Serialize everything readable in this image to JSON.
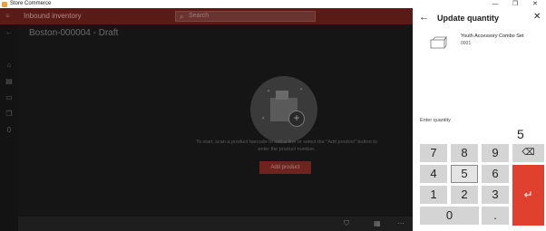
{
  "window": {
    "title": "Store Commerce",
    "min_glyph": "—",
    "max_glyph": "❐",
    "close_glyph": "✕"
  },
  "appbar": {
    "menu_glyph": "≡",
    "title": "Inbound inventory",
    "search_icon_glyph": "⌕",
    "search_placeholder": "Search"
  },
  "rail": {
    "back_glyph": "←",
    "home_glyph": "⌂",
    "products_glyph": "▤",
    "video_glyph": "▭",
    "docs_glyph": "❐",
    "count": "0"
  },
  "main": {
    "page_title": "Boston-000004 - Draft",
    "empty_text": "To start, scan a product barcode to add a line or select the \"Add product\" button to enter the product number.",
    "add_product_label": "Add product",
    "plus_glyph": "+",
    "spark_glyph": "✦"
  },
  "bottombar": {
    "filter_glyph": "⛉",
    "save_glyph": "▦",
    "more_glyph": "⋯"
  },
  "panel": {
    "back_glyph": "←",
    "title": "Update quantity",
    "close_glyph": "✕",
    "product_name": "Youth Accessory Combo Set",
    "product_id": "0001",
    "quantity_label": "Enter quantity",
    "quantity_value": "5"
  },
  "numpad": {
    "k7": "7",
    "k8": "8",
    "k9": "9",
    "k4": "4",
    "k5": "5",
    "k6": "6",
    "k1": "1",
    "k2": "2",
    "k3": "3",
    "k0": "0",
    "dot": ".",
    "backspace_glyph": "⌫",
    "enter_glyph": "↵",
    "selected_key": "5"
  },
  "colors": {
    "accent": "#e0412f",
    "appbar_dimmed": "#5a1a16",
    "overlay_bg": "#151515"
  },
  "icons": [
    "app-icon",
    "menu-icon",
    "search-icon",
    "back-icon",
    "home-icon",
    "products-icon",
    "video-icon",
    "documents-icon",
    "box-plus-icon",
    "filter-icon",
    "save-icon",
    "close-icon",
    "product-icon",
    "backspace-icon",
    "enter-icon"
  ]
}
